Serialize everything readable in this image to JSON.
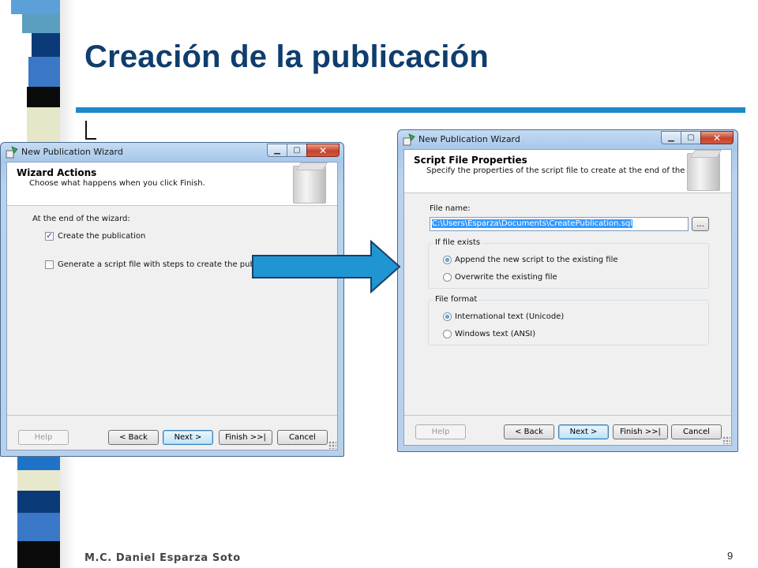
{
  "slide": {
    "title": "Creación de la publicación",
    "author": "M.C. Daniel Esparza Soto",
    "page_number": "9",
    "colors": {
      "title": "#0f3d6e",
      "rule": "#1f88c9",
      "arrow_fill": "#1f96d2"
    }
  },
  "wizard_left": {
    "window_title": "New Publication Wizard",
    "controls": {
      "minimize": "▁",
      "maximize": "▢",
      "close": "✕"
    },
    "page_title": "Wizard Actions",
    "page_subtitle": "Choose what happens when you click Finish.",
    "section_label": "At the end of the wizard:",
    "options": [
      {
        "label": "Create the publication",
        "checked": true,
        "check_glyph": "✓"
      },
      {
        "label": "Generate a script file with steps to create the publication",
        "checked": false
      }
    ],
    "buttons": {
      "help": "Help",
      "back": "< Back",
      "next": "Next >",
      "finish": "Finish >>|",
      "cancel": "Cancel"
    }
  },
  "wizard_right": {
    "window_title": "New Publication Wizard",
    "controls": {
      "minimize": "▁",
      "maximize": "▢",
      "close": "✕"
    },
    "page_title": "Script File Properties",
    "page_subtitle": "Specify the properties of the script file to create at the end of the wizard.",
    "file_name_label": "File name:",
    "file_name_value": "C:\\Users\\Esparza\\Documents\\CreatePublication.sql",
    "browse_label": "...",
    "if_exists": {
      "caption": "If file exists",
      "options": [
        {
          "label": "Append the new script to the existing file",
          "selected": true
        },
        {
          "label": "Overwrite the existing file",
          "selected": false
        }
      ]
    },
    "file_format": {
      "caption": "File format",
      "options": [
        {
          "label": "International text (Unicode)",
          "selected": true
        },
        {
          "label": "Windows text (ANSI)",
          "selected": false
        }
      ]
    },
    "buttons": {
      "help": "Help",
      "back": "< Back",
      "next": "Next >",
      "finish": "Finish >>|",
      "cancel": "Cancel"
    }
  }
}
